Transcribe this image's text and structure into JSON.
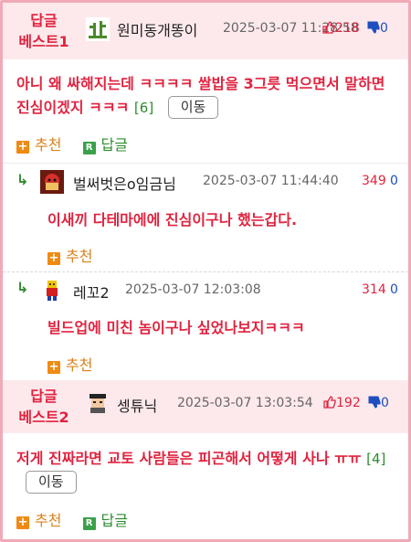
{
  "comments": [
    {
      "badge_line1": "답글",
      "badge_line2": "베스트1",
      "nickname": "원미동개똥이",
      "date": "2025-03-07 11:28:58",
      "up_count": "218",
      "down_count": "0",
      "body": "아니 왜 싸해지는데 ㅋㅋㅋㅋ 쌀밥을 3그릇 먹으면서 말하면 진심이겠지 ㅋㅋㅋ",
      "reply_count": "[6]",
      "move_label": "이동",
      "recommend_label": "추천",
      "reply_label": "답글"
    },
    {
      "nickname": "벌써벗은o임금님",
      "date": "2025-03-07 11:44:40",
      "up_count": "349",
      "down_count": "0",
      "body": "이새끼 다테마에에 진심이구나 했는갑다.",
      "recommend_label": "추천"
    },
    {
      "nickname": "레꼬2",
      "date": "2025-03-07 12:03:08",
      "up_count": "314",
      "down_count": "0",
      "body": "빌드업에 미친 놈이구나 싶었나보지ㅋㅋㅋ",
      "recommend_label": "추천"
    },
    {
      "badge_line1": "답글",
      "badge_line2": "베스트2",
      "nickname": "셍튜닉",
      "date": "2025-03-07 13:03:54",
      "up_count": "192",
      "down_count": "0",
      "body": "저게 진짜라면 교토 사람들은 피곤해서 어떻게 사나 ㅠㅠ",
      "reply_count": "[4]",
      "move_label": "이동",
      "recommend_label": "추천",
      "reply_label": "답글"
    }
  ],
  "icons": {
    "thumb_up": "thumbs-up-icon",
    "thumb_down": "thumbs-down-icon",
    "reply_arrow": "reply-arrow-icon",
    "plus": "plus-icon",
    "r_badge": "r-icon"
  },
  "colors": {
    "accent_red": "#e0233f",
    "down_blue": "#1f4fbf",
    "best_bg": "#fde9ec",
    "border": "#f0aab7",
    "green": "#2e8b2e",
    "orange": "#d9821b"
  }
}
